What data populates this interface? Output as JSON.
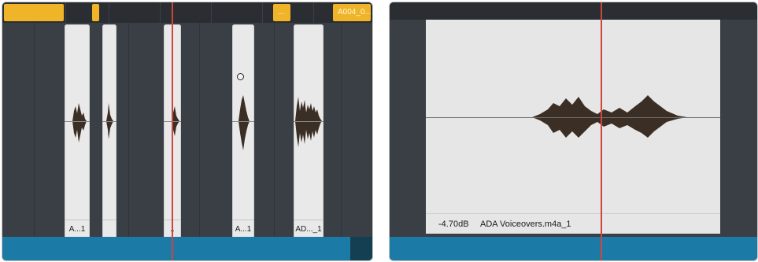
{
  "left_panel": {
    "markers": [
      {
        "label": ""
      },
      {
        "label": ""
      },
      {
        "label": "..."
      },
      {
        "label": "A004_0..."
      }
    ],
    "clips": [
      {
        "name": "A...1"
      },
      {
        "name": ""
      },
      {
        "name": ".."
      },
      {
        "name": "A...1"
      },
      {
        "name": "AD..._1"
      }
    ]
  },
  "right_panel": {
    "clip": {
      "gain": "-4.70dB",
      "name": "ADA Voiceovers.m4a_1"
    }
  },
  "colors": {
    "marker": "#f0b429",
    "playhead": "#d0433f",
    "clip_bg": "#e9e9e9",
    "waveform": "#3b2f25",
    "bottom_bar": "#1c7ba6"
  }
}
